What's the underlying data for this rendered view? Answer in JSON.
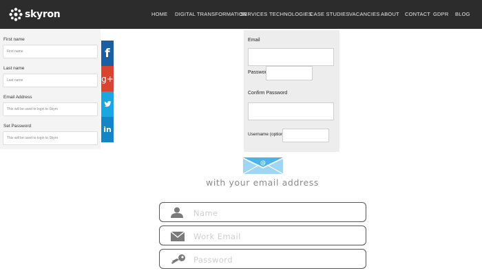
{
  "brand": {
    "name": "skyron"
  },
  "nav": {
    "items": [
      "HOME",
      "DIGITAL TRANSFORMATION",
      "SERVICES",
      "TECHNOLOGIES",
      "CASE STUDIES",
      "VACANCIES",
      "ABOUT",
      "CONTACT",
      "GDPR",
      "BLOG"
    ]
  },
  "left_form": {
    "first_name": {
      "label": "First name",
      "placeholder": "First name"
    },
    "last_name": {
      "label": "Last name",
      "placeholder": "Last name"
    },
    "email": {
      "label": "Email Address",
      "placeholder": "This will be used to login to Skyro"
    },
    "password": {
      "label": "Set Password",
      "placeholder": "This will be used to login to Skyro"
    }
  },
  "social": {
    "facebook": {
      "glyph": "f",
      "color": "#1b5fa3"
    },
    "googleplus": {
      "glyph": "g+",
      "color": "#d9432f"
    },
    "twitter": {
      "glyph": "t",
      "color": "#1aa6de"
    },
    "linkedin": {
      "glyph": "in",
      "color": "#1486c6"
    }
  },
  "right_form": {
    "email_label": "Email",
    "password_label": "Password",
    "confirm_label": "Confirm Password",
    "username_label": "Username (optional)"
  },
  "signup": {
    "tagline": "with your email address",
    "name_placeholder": "Name",
    "email_placeholder": "Work Email",
    "password_placeholder": "Password"
  },
  "colors": {
    "topbar": "#2c2c2c",
    "envelope": "#4bb3e8"
  }
}
